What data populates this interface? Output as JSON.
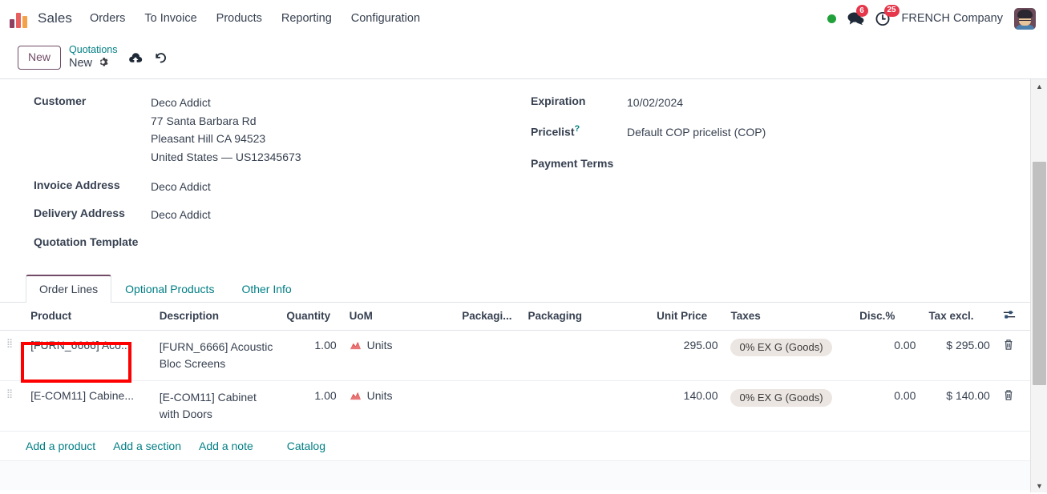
{
  "navbar": {
    "app_logo": "sales-app-logo",
    "app_title": "Sales",
    "menu": [
      {
        "label": "Orders"
      },
      {
        "label": "To Invoice"
      },
      {
        "label": "Products"
      },
      {
        "label": "Reporting"
      },
      {
        "label": "Configuration"
      }
    ],
    "status_indicator_color": "#21a13b",
    "messages_badge": "6",
    "activities_badge": "25",
    "company": "FRENCH Company"
  },
  "control_panel": {
    "new_button": "New",
    "breadcrumb_parent": "Quotations",
    "breadcrumb_current": "New",
    "save_icon": "cloud-upload-icon",
    "discard_icon": "undo-icon",
    "settings_icon": "gear-icon"
  },
  "form": {
    "left": [
      {
        "label": "Customer",
        "value": "Deco Addict",
        "extra_lines": [
          "77 Santa Barbara Rd",
          "Pleasant Hill CA 94523",
          "United States — US12345673"
        ]
      },
      {
        "label": "Invoice Address",
        "value": "Deco Addict",
        "extra_lines": []
      },
      {
        "label": "Delivery Address",
        "value": "Deco Addict",
        "extra_lines": []
      },
      {
        "label": "Quotation Template",
        "value": "",
        "extra_lines": []
      }
    ],
    "right": [
      {
        "label": "Expiration",
        "value": "10/02/2024",
        "help": ""
      },
      {
        "label": "Pricelist",
        "value": "Default COP pricelist (COP)",
        "help": "?"
      },
      {
        "label": "Payment Terms",
        "value": "",
        "help": ""
      }
    ]
  },
  "notebook": {
    "tabs": [
      {
        "label": "Order Lines",
        "active": true
      },
      {
        "label": "Optional Products",
        "active": false
      },
      {
        "label": "Other Info",
        "active": false
      }
    ],
    "highlight_color": "#ff0000"
  },
  "order_lines": {
    "columns": [
      "Product",
      "Description",
      "Quantity",
      "UoM",
      "Packagi...",
      "Packaging",
      "Unit Price",
      "Taxes",
      "Disc.%",
      "Tax excl."
    ],
    "config_icon": "column-options-icon",
    "rows": [
      {
        "handle": "drag-handle",
        "product": "[FURN_6666] Aco...",
        "description": "[FURN_6666] Acoustic Bloc Screens",
        "quantity": "1.00",
        "uom_icon": "area-chart-icon",
        "uom": "Units",
        "packaging_qty": "",
        "packaging": "",
        "unit_price": "295.00",
        "taxes": "0% EX G (Goods)",
        "discount": "0.00",
        "tax_excl": "$ 295.00",
        "delete_icon": "trash-icon"
      },
      {
        "handle": "drag-handle",
        "product": "[E-COM11] Cabine...",
        "description": "[E-COM11] Cabinet with Doors",
        "quantity": "1.00",
        "uom_icon": "area-chart-icon",
        "uom": "Units",
        "packaging_qty": "",
        "packaging": "",
        "unit_price": "140.00",
        "taxes": "0% EX G (Goods)",
        "discount": "0.00",
        "tax_excl": "$ 140.00",
        "delete_icon": "trash-icon"
      }
    ],
    "add_links": [
      {
        "label": "Add a product"
      },
      {
        "label": "Add a section"
      },
      {
        "label": "Add a note"
      },
      {
        "label": "Catalog"
      }
    ]
  },
  "scrollbar": {
    "up_arrow": "▲",
    "down_arrow": "▼"
  }
}
